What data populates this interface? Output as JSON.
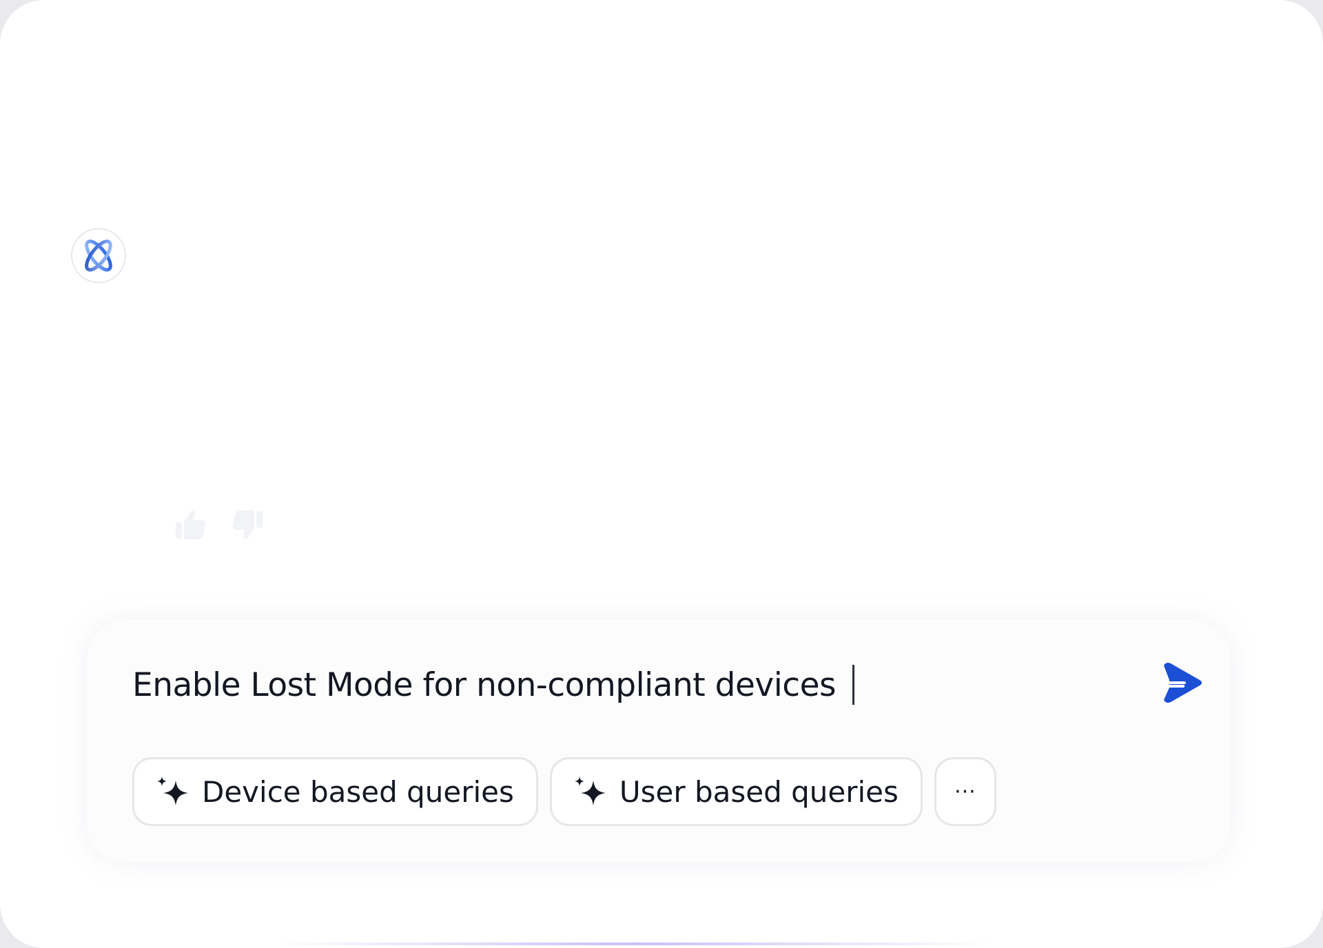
{
  "assistant": {
    "avatar_icon": "atom-logo-icon",
    "brand_color": "#1a5ae0"
  },
  "feedback": {
    "like_icon": "thumbs-up-icon",
    "dislike_icon": "thumbs-down-icon"
  },
  "composer": {
    "input_value": "Enable Lost Mode for non-compliant devices",
    "send_icon": "send-arrow-icon",
    "send_color": "#1a4fd6",
    "chips": [
      {
        "label": "Device based queries",
        "icon": "sparkle-icon"
      },
      {
        "label": "User based queries",
        "icon": "sparkle-icon"
      }
    ],
    "more_label": "···"
  }
}
